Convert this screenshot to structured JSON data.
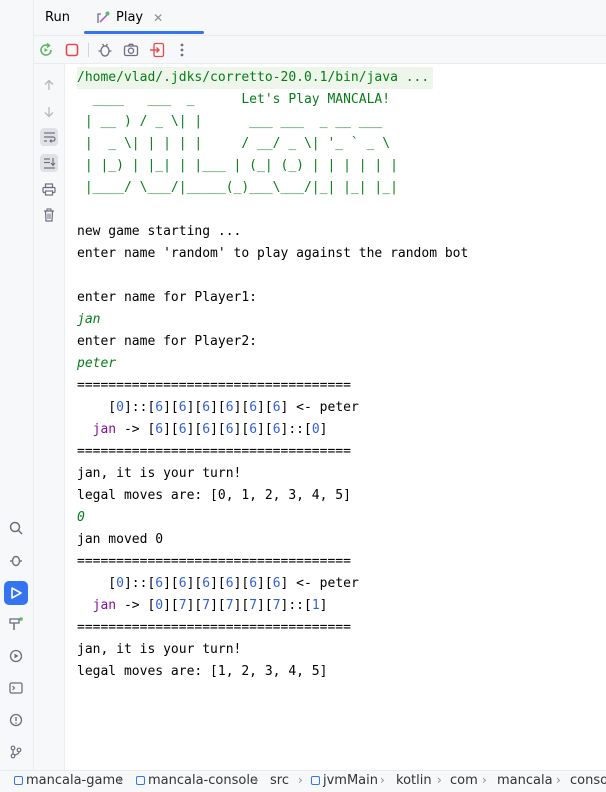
{
  "tabs": {
    "run_label": "Run",
    "play_label": "Play",
    "close_glyph": "✕"
  },
  "console": {
    "java_path": "/home/vlad/.jdks/corretto-20.0.1/bin/java ...",
    "banner": [
      "  ____   ___  _      Let's Play MANCALA!",
      " | __ ) / _ \\| |      ___ ___  _ __ ___",
      " |  _ \\| | | | |     / __/ _ \\| '_ ` _ \\",
      " | |_) | |_| | |___ | (_| (_) | | | | | |",
      " |____/ \\___/|_____(_)___\\___/|_| |_| |_|"
    ],
    "new_game": "new game starting ...",
    "random_hint": "enter name 'random' to play against the random bot",
    "prompt_p1": "enter name for Player1:",
    "input_p1": "jan",
    "prompt_p2": "enter name for Player2:",
    "input_p2": "peter",
    "divider": "===================================",
    "board1_top": "    [0]::[6][6][6][6][6][6] <- peter",
    "board1_bottom_name": "  jan",
    "board1_bottom_rest": " -> [6][6][6][6][6][6]::[0]",
    "turn1": "jan, it is your turn!",
    "legal1": "legal moves are: [0, 1, 2, 3, 4, 5]",
    "input_move": "0",
    "moved": "jan moved 0",
    "board2_top": "    [0]::[6][6][6][6][6][6] <- peter",
    "board2_bottom_name": "  jan",
    "board2_bottom_rest": " -> [0][7][7][7][7][7]::[1]",
    "turn2": "jan, it is your turn!",
    "legal2": "legal moves are: [1, 2, 3, 4, 5]"
  },
  "breadcrumbs": [
    "mancala-game",
    "mancala-console",
    "src",
    "jvmMain",
    "kotlin",
    "com",
    "mancala",
    "console"
  ],
  "colors": {
    "accent": "#3574f0",
    "console_green": "#067d17",
    "number_blue": "#2f5fde",
    "name_purple": "#871094",
    "stop_red": "#e5484d"
  }
}
